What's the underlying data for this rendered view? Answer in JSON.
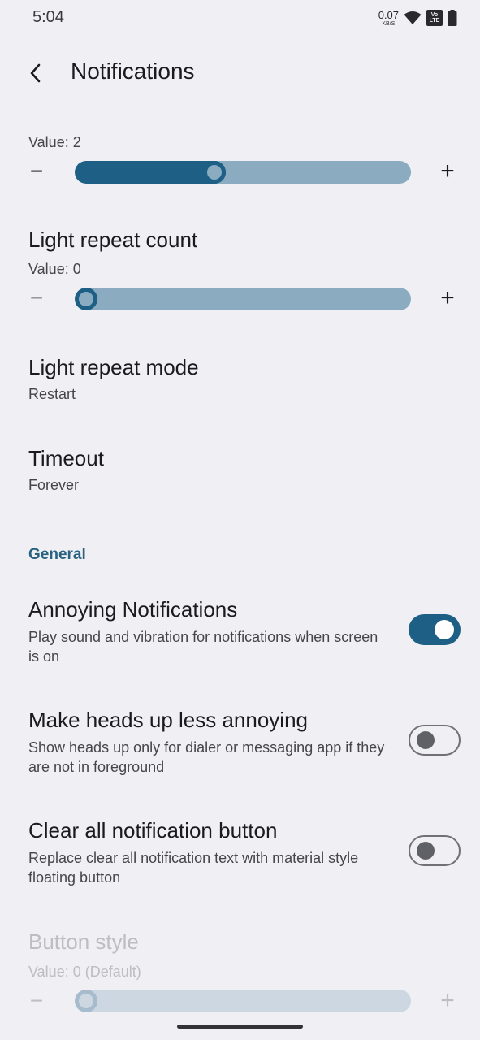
{
  "status_bar": {
    "time": "5:04",
    "net_speed": "0.07",
    "net_unit": "KB/S",
    "volte_top": "Vo",
    "volte_bottom": "LTE",
    "icons": [
      "wifi-icon",
      "volte-icon",
      "battery-icon"
    ]
  },
  "header": {
    "back_icon": "back-arrow-icon",
    "title": "Notifications"
  },
  "sliders": {
    "top": {
      "value_label": "Value: 2",
      "fraction": 0.41
    },
    "light_repeat_count": {
      "title": "Light repeat count",
      "value_label": "Value: 0",
      "fraction": 0.0
    },
    "button_style": {
      "title": "Button style",
      "value_label": "Value: 0 (Default)",
      "fraction": 0.0,
      "enabled": false
    }
  },
  "controls": {
    "minus": "−",
    "plus": "+"
  },
  "light_repeat_mode": {
    "title": "Light repeat mode",
    "value": "Restart"
  },
  "timeout": {
    "title": "Timeout",
    "value": "Forever"
  },
  "section_general": "General",
  "toggles": [
    {
      "title": "Annoying Notifications",
      "summary": "Play sound and vibration for notifications when screen is on",
      "on": true
    },
    {
      "title": "Make heads up less annoying",
      "summary": "Show heads up only for dialer or messaging app if they are not in foreground",
      "on": false
    },
    {
      "title": "Clear all notification button",
      "summary": "Replace clear all notification text with material style floating button",
      "on": false
    }
  ],
  "colors": {
    "background": "#f0eff3",
    "accent": "#1e5f85",
    "track": "#8aabc0",
    "section": "#2a6283"
  }
}
